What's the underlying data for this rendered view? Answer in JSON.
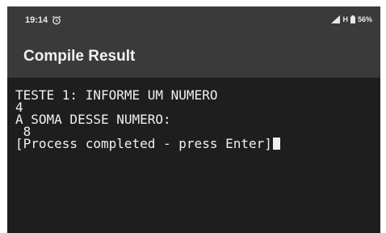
{
  "status_bar": {
    "time": "19:14",
    "network": "H",
    "battery": "56%",
    "icons": [
      "alarm-icon",
      "signal-icon",
      "battery-icon"
    ]
  },
  "app_bar": {
    "title": "Compile Result"
  },
  "console": {
    "lines": [
      "TESTE 1: INFORME UM NUMERO",
      "4",
      "A SOMA DESSE NUMERO:",
      " 8",
      "[Process completed - press Enter]"
    ]
  },
  "colors": {
    "bar_background": "#3a3a3a",
    "console_background": "#1e1e1e",
    "text": "#f0f0f0"
  }
}
